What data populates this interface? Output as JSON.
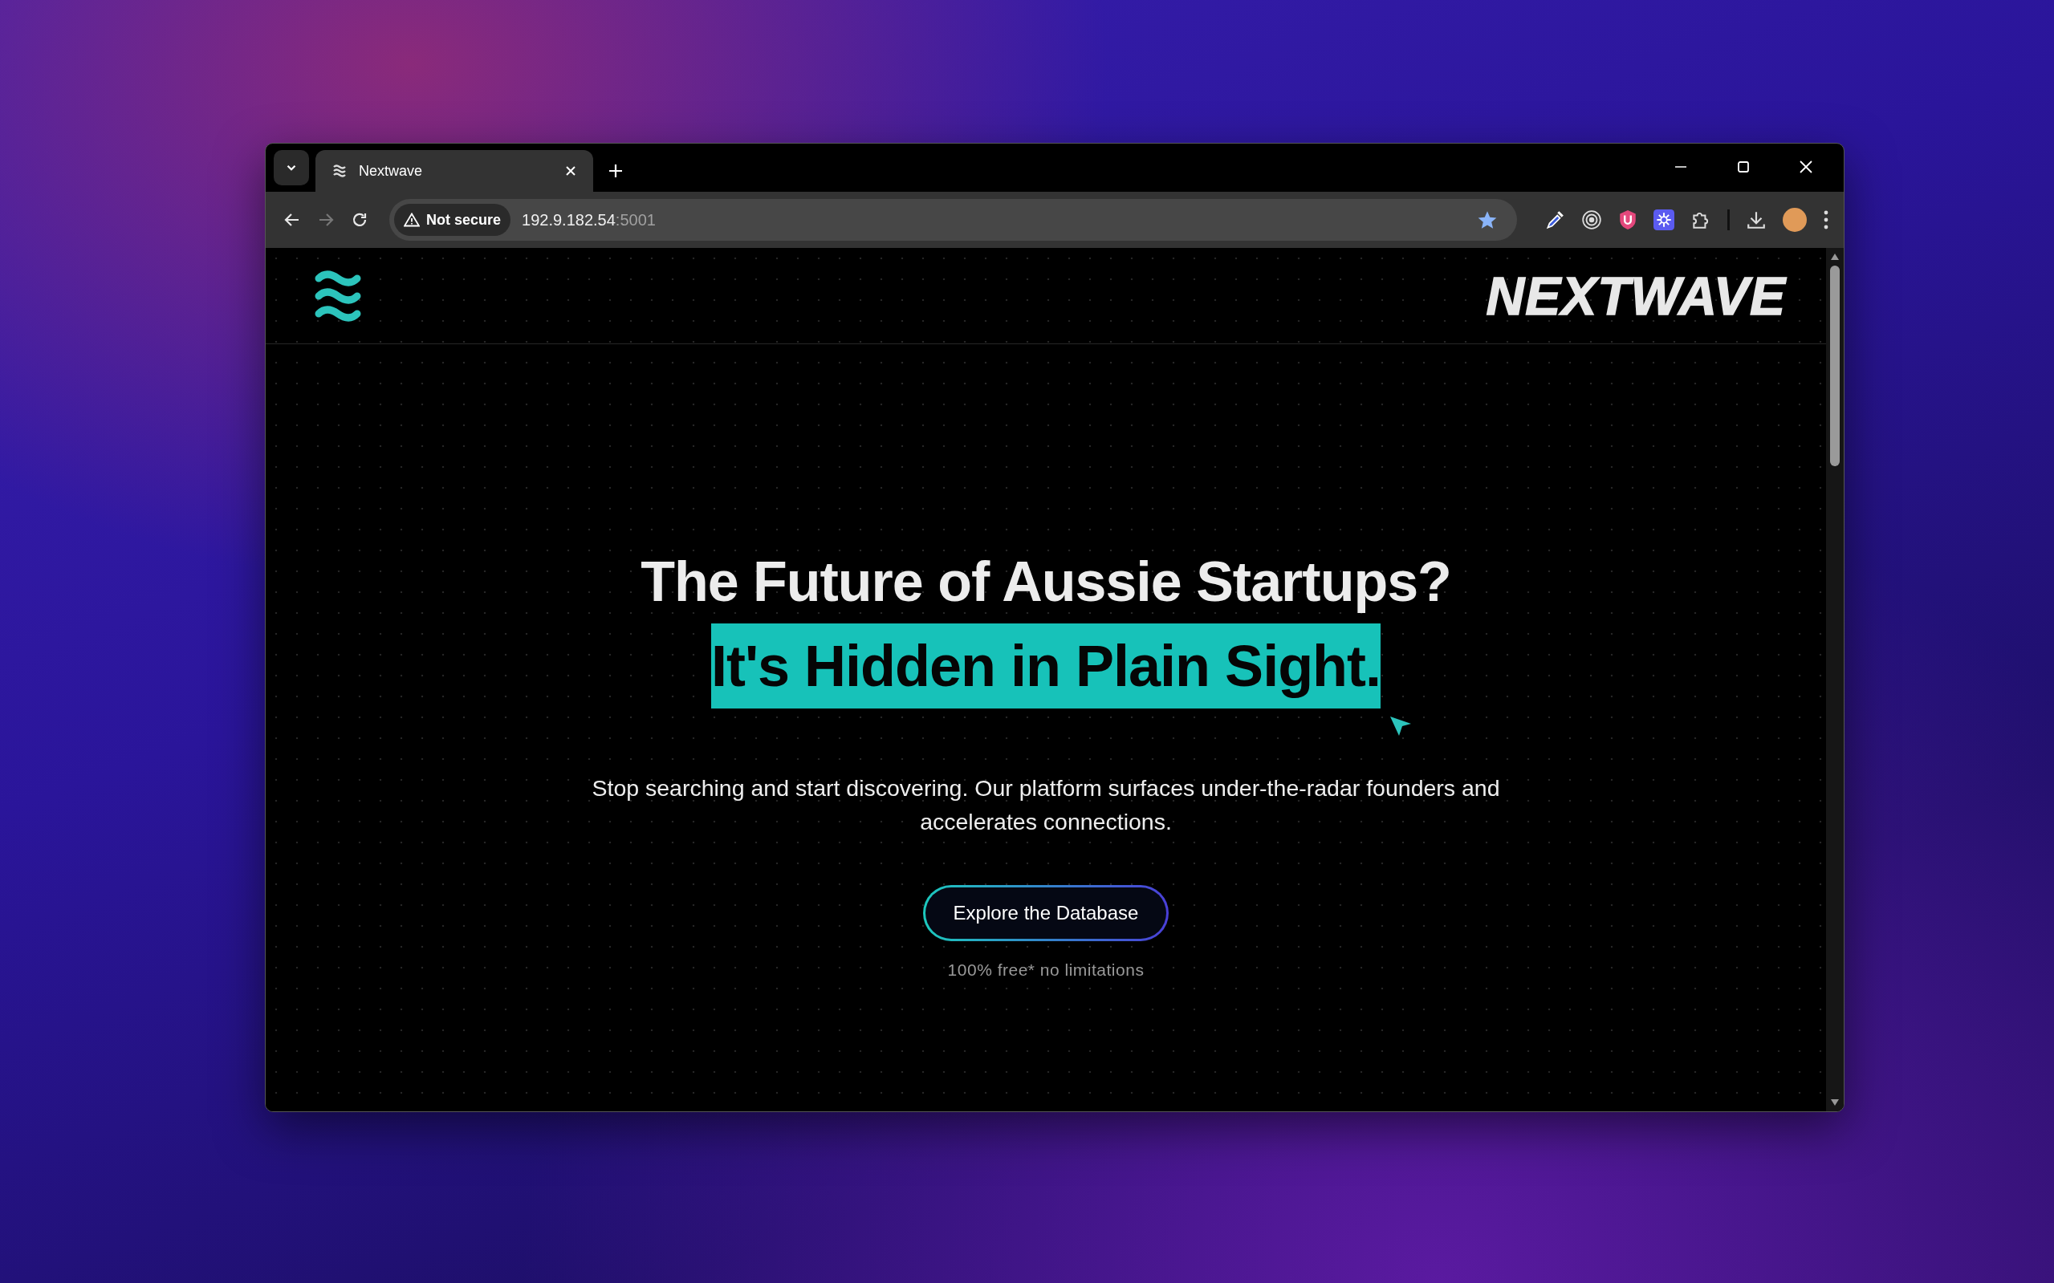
{
  "browser": {
    "tabs": [
      {
        "title": "Nextwave",
        "selected": true
      }
    ],
    "address": {
      "security": "Not secure",
      "host": "192.9.182.54",
      "port": ":5001"
    }
  },
  "site": {
    "brand": "NEXTWAVE",
    "hero": {
      "title": "The Future of Aussie Startups?",
      "highlight": "It's Hidden in Plain Sight.",
      "text": "Stop searching and start discovering. Our platform surfaces under-the-radar founders and accelerates connections.",
      "button": "Explore the Database",
      "note": "100% free* no limitations"
    }
  }
}
